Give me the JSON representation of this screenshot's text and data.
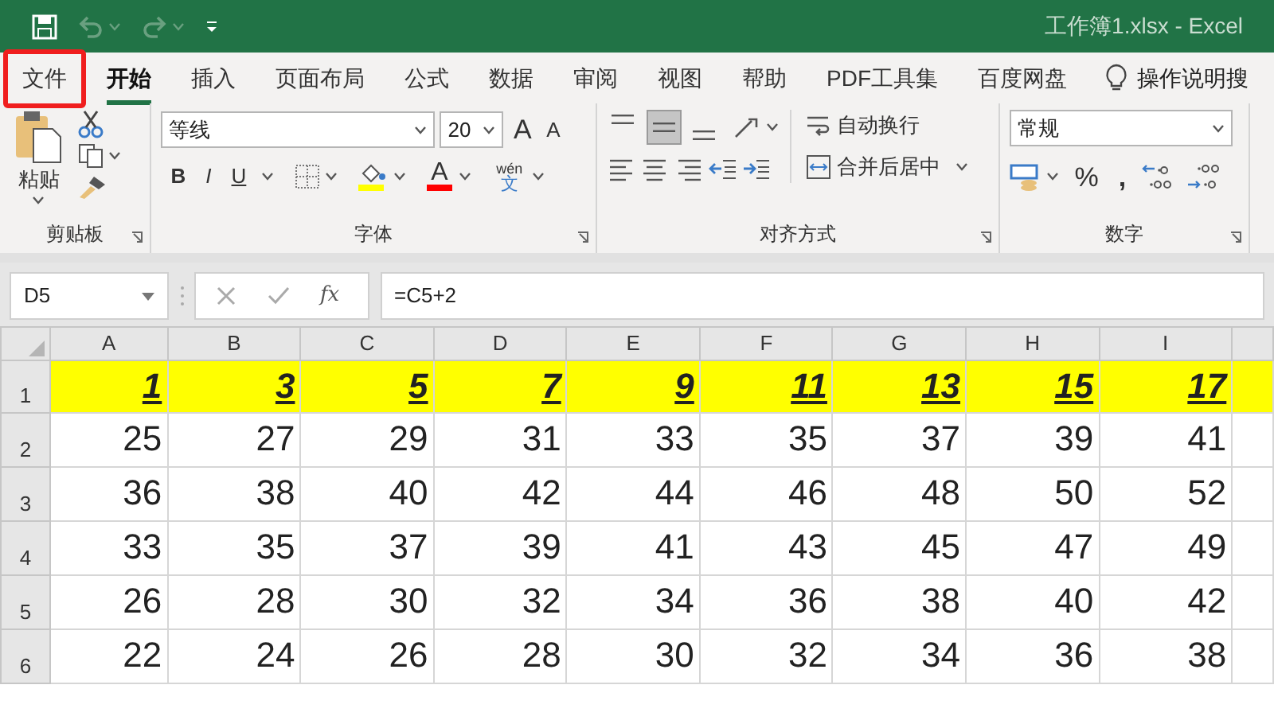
{
  "title_bar": {
    "title": "工作簿1.xlsx  -  Excel"
  },
  "tabs": [
    {
      "label": "文件",
      "selected": false,
      "marked": true
    },
    {
      "label": "开始",
      "selected": true,
      "marked": false
    },
    {
      "label": "插入",
      "selected": false,
      "marked": false
    },
    {
      "label": "页面布局",
      "selected": false,
      "marked": false
    },
    {
      "label": "公式",
      "selected": false,
      "marked": false
    },
    {
      "label": "数据",
      "selected": false,
      "marked": false
    },
    {
      "label": "审阅",
      "selected": false,
      "marked": false
    },
    {
      "label": "视图",
      "selected": false,
      "marked": false
    },
    {
      "label": "帮助",
      "selected": false,
      "marked": false
    },
    {
      "label": "PDF工具集",
      "selected": false,
      "marked": false
    },
    {
      "label": "百度网盘",
      "selected": false,
      "marked": false
    }
  ],
  "tell_me": {
    "label": "操作说明搜"
  },
  "ribbon": {
    "clipboard": {
      "paste_label": "粘贴",
      "title": "剪贴板"
    },
    "font": {
      "font_name": "等线",
      "font_size": "20",
      "grow_label": "A",
      "shrink_label": "A",
      "style_buttons": [
        "B",
        "I",
        "U"
      ],
      "color_label": "A",
      "phonetic_top": "wén",
      "phonetic_bottom": "文",
      "title": "字体"
    },
    "alignment": {
      "vertical_buttons": [
        {
          "selected": false
        },
        {
          "selected": true
        },
        {
          "selected": false
        }
      ],
      "wrap_label": "自动换行",
      "merge_label": "合并后居中",
      "title": "对齐方式"
    },
    "number": {
      "format": "常规",
      "percent_label": "%",
      "comma_label": ",",
      "title": "数字"
    }
  },
  "formula_bar": {
    "name_box": "D5",
    "fx_label": "fx",
    "formula": "=C5+2"
  },
  "sheet": {
    "columns": [
      "A",
      "B",
      "C",
      "D",
      "E",
      "F",
      "G",
      "H",
      "I"
    ],
    "rows": [
      {
        "header": "1",
        "kind": "emphasis",
        "cells": [
          "1",
          "3",
          "5",
          "7",
          "9",
          "11",
          "13",
          "15",
          "17"
        ]
      },
      {
        "header": "2",
        "kind": "plain",
        "cells": [
          "25",
          "27",
          "29",
          "31",
          "33",
          "35",
          "37",
          "39",
          "41"
        ]
      },
      {
        "header": "3",
        "kind": "plain",
        "cells": [
          "36",
          "38",
          "40",
          "42",
          "44",
          "46",
          "48",
          "50",
          "52"
        ]
      },
      {
        "header": "4",
        "kind": "plain",
        "cells": [
          "33",
          "35",
          "37",
          "39",
          "41",
          "43",
          "45",
          "47",
          "49"
        ]
      },
      {
        "header": "5",
        "kind": "plain",
        "cells": [
          "26",
          "28",
          "30",
          "32",
          "34",
          "36",
          "38",
          "40",
          "42"
        ]
      },
      {
        "header": "6",
        "kind": "plain",
        "cells": [
          "22",
          "24",
          "26",
          "28",
          "30",
          "32",
          "34",
          "36",
          "38"
        ]
      }
    ]
  }
}
